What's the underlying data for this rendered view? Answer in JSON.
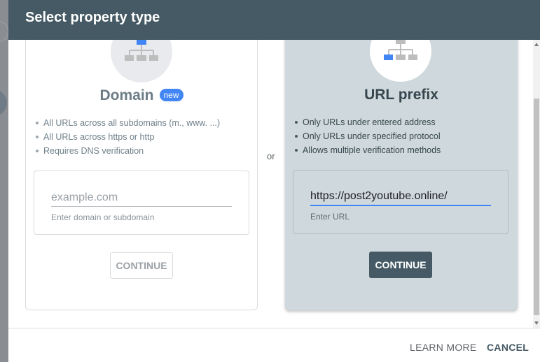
{
  "dialog": {
    "title": "Select property type",
    "or_label": "or"
  },
  "domain_card": {
    "title": "Domain",
    "badge": "new",
    "bullets": [
      "All URLs across all subdomains (m., www. ...)",
      "All URLs across https or http",
      "Requires DNS verification"
    ],
    "input_placeholder": "example.com",
    "input_value": "",
    "helper": "Enter domain or subdomain",
    "continue_label": "CONTINUE"
  },
  "url_card": {
    "title": "URL prefix",
    "bullets": [
      "Only URLs under entered address",
      "Only URLs under specified protocol",
      "Allows multiple verification methods"
    ],
    "input_value": "https://post2youtube.online/",
    "helper": "Enter URL",
    "continue_label": "CONTINUE"
  },
  "footer": {
    "learn_more": "LEARN MORE",
    "cancel": "CANCEL"
  },
  "colors": {
    "header": "#455a64",
    "selected_card": "#cfd8dc",
    "badge": "#4285f4",
    "input_focus": "#4285f4"
  }
}
